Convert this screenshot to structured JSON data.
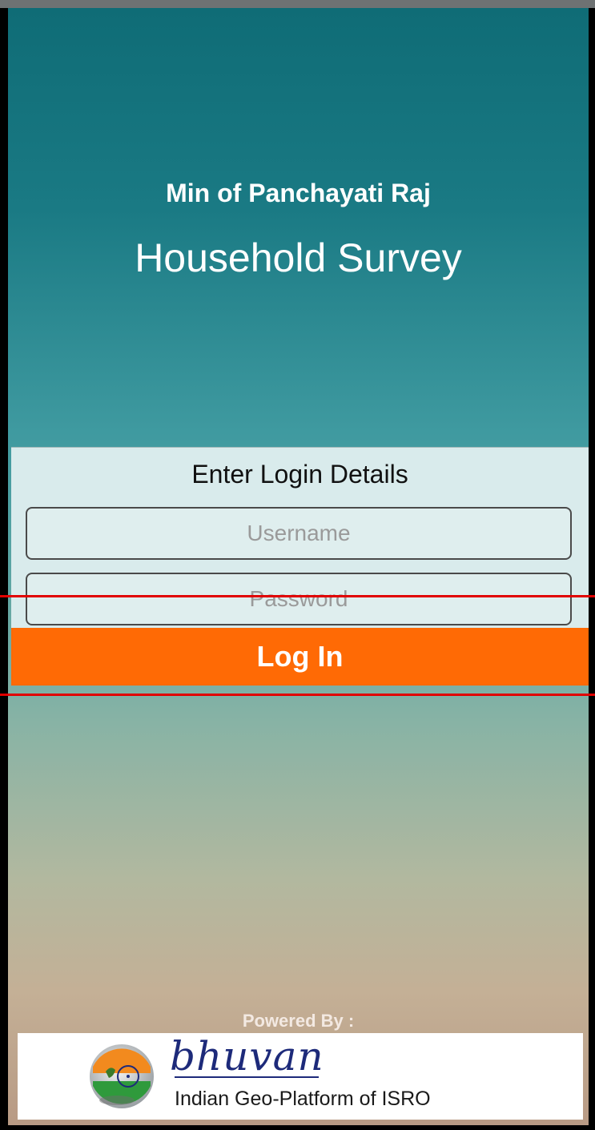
{
  "header": {
    "subtitle": "Min of Panchayati Raj",
    "title": "Household Survey"
  },
  "login": {
    "heading": "Enter Login Details",
    "username_placeholder": "Username",
    "password_placeholder": "Password",
    "button_label": "Log In"
  },
  "footer": {
    "powered_by": "Powered By :",
    "brand_name": "bhuvan",
    "tagline": "Indian Geo-Platform of ISRO"
  },
  "colors": {
    "accent": "#ff6a05",
    "panel": "#d9ebec",
    "annotation": "#e10000"
  },
  "icons": {
    "emblem": "isro-globe-emblem-icon"
  }
}
